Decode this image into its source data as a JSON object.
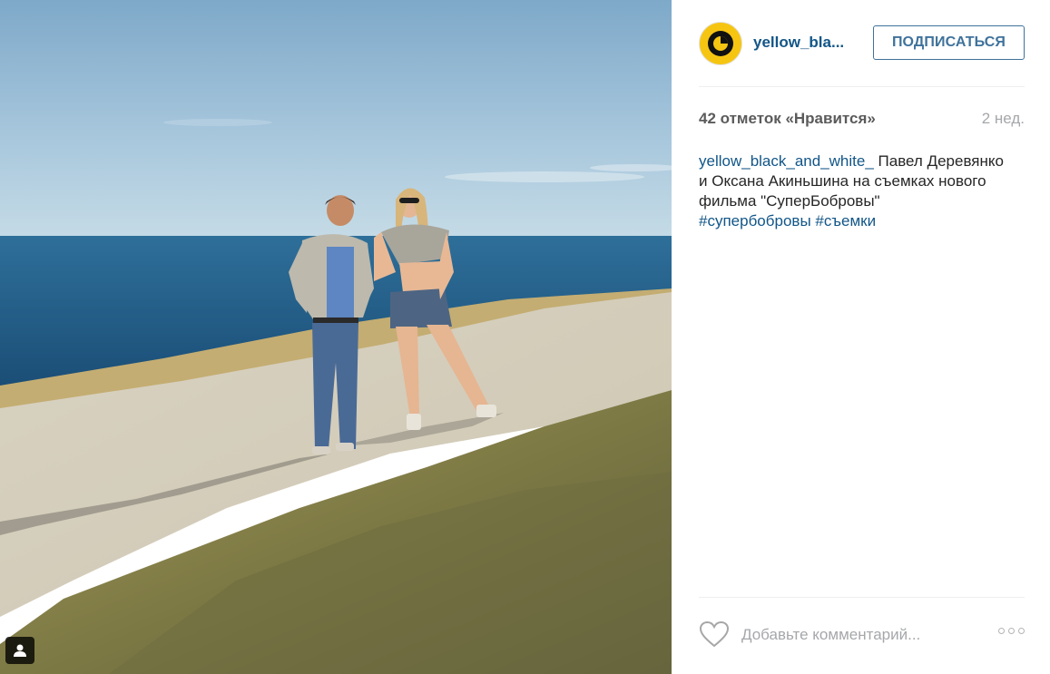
{
  "photo": {
    "icon": "user-tag-icon",
    "tag_badge_icon": "person-icon"
  },
  "header": {
    "avatar_icon": "yellow-black-logo-icon",
    "username": "yellow_bla...",
    "follow_label": "ПОДПИСАТЬСЯ"
  },
  "meta": {
    "likes": "42 отметок «Нравится»",
    "time_ago": "2 нед."
  },
  "caption": {
    "username": "yellow_black_and_white_",
    "text": " Павел Деревянко и Оксана Акиньшина на съемках нового фильма \"СуперБобровы\"",
    "hashtags": [
      "#супербобровы",
      "#съемки"
    ]
  },
  "comment": {
    "placeholder": "Добавьте комментарий...",
    "like_icon": "heart-icon",
    "more_icon": "more-options-icon"
  },
  "colors": {
    "link": "#125688",
    "button": "#3f729b",
    "muted": "#a5a7aa",
    "avatar_bg": "#f6c512"
  }
}
